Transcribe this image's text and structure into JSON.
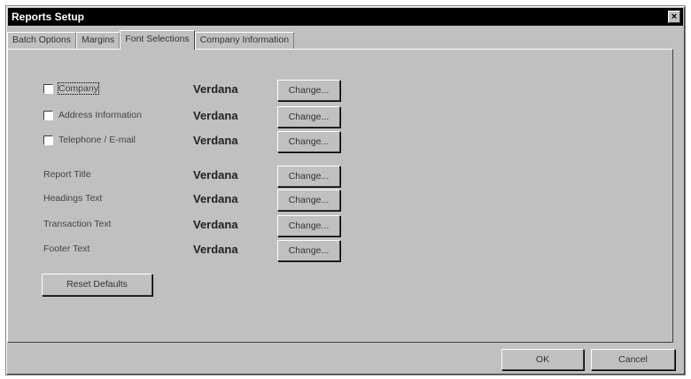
{
  "window": {
    "title": "Reports Setup",
    "close_glyph": "×"
  },
  "tabs": [
    {
      "label": "Batch Options",
      "active": false
    },
    {
      "label": "Margins",
      "active": false
    },
    {
      "label": "Font Selections",
      "active": true
    },
    {
      "label": "Company Information",
      "active": false
    }
  ],
  "font_rows": [
    {
      "label": "Company",
      "checkbox": true,
      "checked": false,
      "font": "Verdana",
      "button": "Change..."
    },
    {
      "label": "Address Information",
      "checkbox": true,
      "checked": false,
      "font": "Verdana",
      "button": "Change..."
    },
    {
      "label": "Telephone / E-mail",
      "checkbox": true,
      "checked": false,
      "font": "Verdana",
      "button": "Change..."
    },
    {
      "label": "Report Title",
      "checkbox": false,
      "font": "Verdana",
      "button": "Change..."
    },
    {
      "label": "Headings Text",
      "checkbox": false,
      "font": "Verdana",
      "button": "Change..."
    },
    {
      "label": "Transaction Text",
      "checkbox": false,
      "font": "Verdana",
      "button": "Change..."
    },
    {
      "label": "Footer Text",
      "checkbox": false,
      "font": "Verdana",
      "button": "Change..."
    }
  ],
  "reset_label": "Reset Defaults",
  "footer": {
    "ok_label": "OK",
    "cancel_label": "Cancel"
  }
}
